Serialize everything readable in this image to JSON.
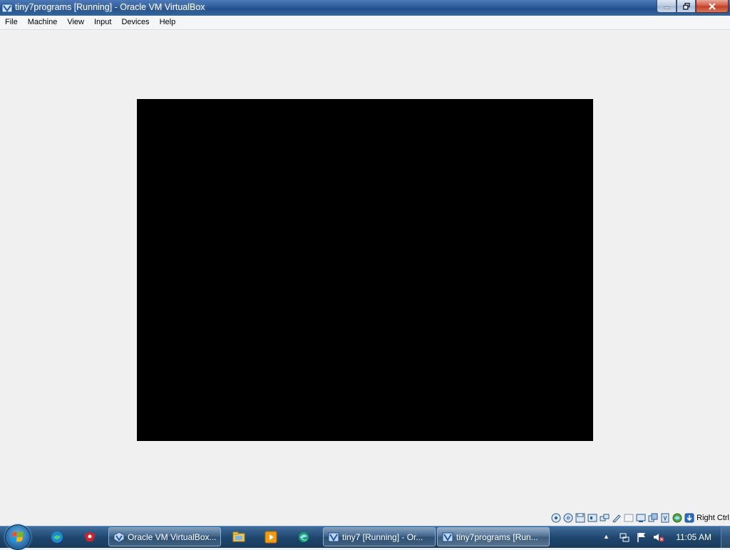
{
  "window": {
    "title": "tiny7programs [Running] - Oracle VM VirtualBox",
    "icon": "virtualbox-icon",
    "controls": [
      "minimize-button",
      "maximize-button",
      "close-button"
    ]
  },
  "menubar": {
    "items": [
      "File",
      "Machine",
      "View",
      "Input",
      "Devices",
      "Help"
    ]
  },
  "vm_display": {
    "background": "#000000"
  },
  "statusbar": {
    "icons": [
      "hard-disk-icon",
      "optical-drive-icon",
      "floppy-icon",
      "audio-icon",
      "network-icon",
      "usb-icon",
      "shared-folders-icon",
      "display-icon",
      "video-capture-icon",
      "cpu-icon",
      "guest-additions-icon",
      "mouse-integration-icon",
      "keyboard-icon"
    ],
    "host_key": "Right Ctrl"
  },
  "taskbar": {
    "start_icon": "windows-start-icon",
    "pinned": [
      "edge-icon",
      "app-icon"
    ],
    "buttons": [
      {
        "label": "Oracle VM VirtualBox...",
        "icon": "virtualbox-icon"
      },
      {
        "label": "tiny7 [Running] - Or...",
        "icon": "virtualbox-vm-icon"
      },
      {
        "label": "tiny7programs [Run...",
        "icon": "virtualbox-vm-icon"
      }
    ],
    "quick_launch": [
      "file-explorer-icon",
      "media-player-icon",
      "edge-legacy-icon"
    ],
    "tray": {
      "icons": [
        "show-hidden-icons-arrow",
        "network-icon",
        "action-center-flag-icon",
        "volume-muted-icon"
      ],
      "clock": "11:05 AM"
    }
  },
  "colors": {
    "title_bar": "#2d5b9b",
    "taskbar": "#20476e",
    "workspace": "#f0f0f0"
  }
}
